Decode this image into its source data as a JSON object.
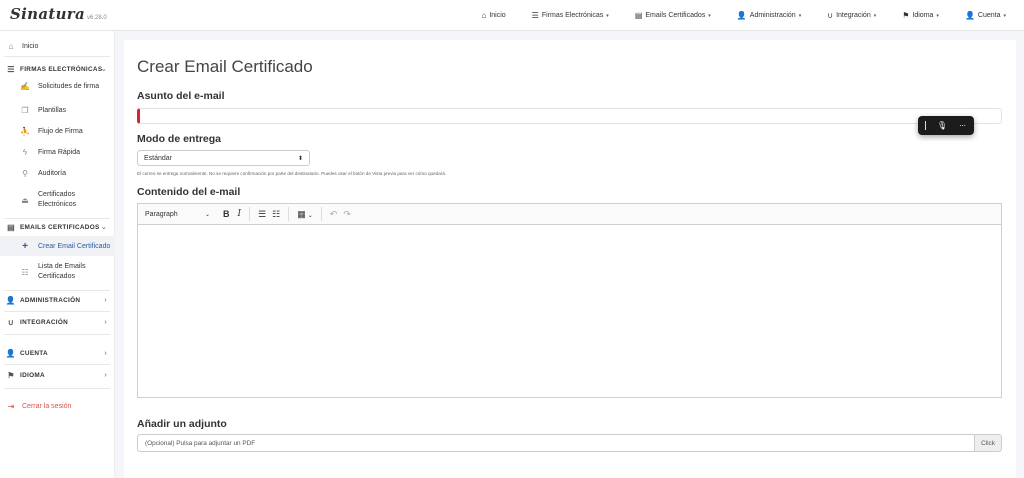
{
  "brand": {
    "name": "Sinatura",
    "version": "v6.28.0"
  },
  "nav": [
    {
      "id": "inicio",
      "icon": "home-icon",
      "glyph": "⌂",
      "label": "Inicio",
      "dropdown": false
    },
    {
      "id": "firmas",
      "icon": "list-icon",
      "glyph": "☰",
      "label": "Firmas Electrónicas",
      "dropdown": true
    },
    {
      "id": "emails",
      "icon": "list-alt-icon",
      "glyph": "▤",
      "label": "Emails Certificados",
      "dropdown": true
    },
    {
      "id": "admin",
      "icon": "user-plus-icon",
      "glyph": "👤",
      "label": "Administración",
      "dropdown": true
    },
    {
      "id": "integracion",
      "icon": "magnet-icon",
      "glyph": "∪",
      "label": "Integración",
      "dropdown": true
    },
    {
      "id": "idioma",
      "icon": "flag-icon",
      "glyph": "⚑",
      "label": "Idioma",
      "dropdown": true
    },
    {
      "id": "cuenta",
      "icon": "user-icon",
      "glyph": "👤",
      "label": "Cuenta",
      "dropdown": true
    }
  ],
  "sidebar": {
    "inicio": {
      "icon": "home-icon",
      "glyph": "⌂",
      "label": "Inicio"
    },
    "firmas_section": {
      "icon": "list-icon",
      "glyph": "☰",
      "label": "FIRMAS ELECTRÓNICAS"
    },
    "firmas_items": [
      {
        "icon": "file-signature-icon",
        "glyph": "✍",
        "label": "Solicitudes de firma"
      },
      {
        "icon": "copy-icon",
        "glyph": "❐",
        "label": "Plantillas"
      },
      {
        "icon": "users-icon",
        "glyph": "⛹",
        "label": "Flujo de Firma"
      },
      {
        "icon": "bolt-icon",
        "glyph": "ϟ",
        "label": "Firma Rápida"
      },
      {
        "icon": "search-icon",
        "glyph": "⚲",
        "label": "Auditoría"
      },
      {
        "icon": "stamp-icon",
        "glyph": "⏏",
        "label": "Certificados Electrónicos"
      }
    ],
    "emails_section": {
      "icon": "list-alt-icon",
      "glyph": "▤",
      "label": "EMAILS CERTIFICADOS"
    },
    "emails_items": [
      {
        "icon": "plus-icon",
        "glyph": "+",
        "label": "Crear Email Certificado",
        "active": true
      },
      {
        "icon": "list-ul-icon",
        "glyph": "☷",
        "label": "Lista de Emails Certificados",
        "active": false
      }
    ],
    "admin_section": {
      "icon": "user-plus-icon",
      "glyph": "👤",
      "label": "ADMINISTRACIÓN"
    },
    "integracion_section": {
      "icon": "magnet-icon",
      "glyph": "∪",
      "label": "INTEGRACIÓN"
    },
    "cuenta_section": {
      "icon": "user-icon",
      "glyph": "👤",
      "label": "CUENTA"
    },
    "idioma_section": {
      "icon": "flag-icon",
      "glyph": "⚑",
      "label": "IDIOMA"
    },
    "logout": {
      "icon": "sign-out-icon",
      "glyph": "⇥",
      "label": "Cerrar la sesión"
    }
  },
  "page": {
    "title": "Crear Email Certificado",
    "subject_label": "Asunto del e-mail",
    "subject_value": "",
    "delivery_label": "Modo de entrega",
    "delivery_selected": "Estándar",
    "delivery_help": "El correo se entrega normalmente. No se requiere confirmación por parte del destinatario. Puedes usar el botón de Vista previa para ver cómo quedará.",
    "content_label": "Contenido del e-mail",
    "editor": {
      "paragraph": "Paragraph"
    },
    "attachment_label": "Añadir un adjunto",
    "attachment_placeholder": "(Opcional) Pulsa para adjuntar un PDF",
    "attachment_button": "Click"
  },
  "colors": {
    "accent": "#2c5aa0",
    "error": "#d9232e",
    "logout": "#d9534f"
  }
}
